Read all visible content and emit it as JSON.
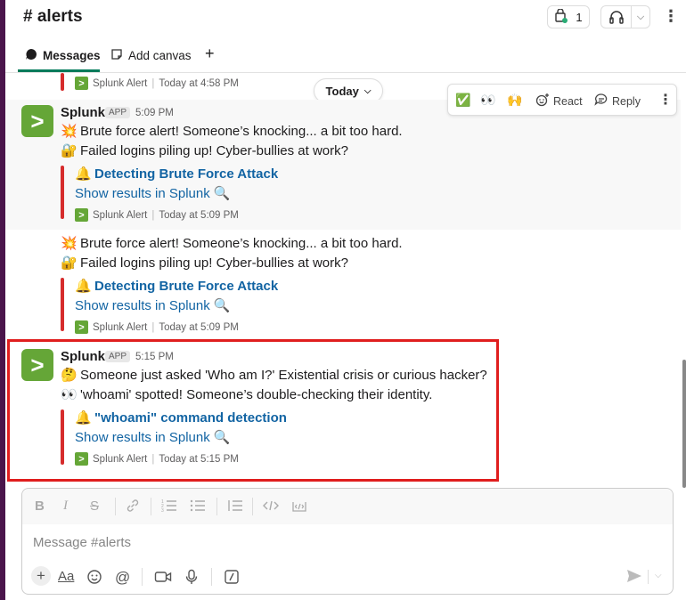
{
  "header": {
    "channel_title": "# alerts",
    "huddle_count": "1",
    "icons": [
      "huddle-icon",
      "headphones-icon",
      "chevron-down-icon",
      "more-vertical-icon"
    ]
  },
  "tabs": {
    "messages": "Messages",
    "add_canvas": "Add canvas",
    "add": "+"
  },
  "date_divider": "Today",
  "hover_actions": {
    "react_label": "React",
    "reply_label": "Reply",
    "quick_reactions": [
      "✅",
      "👀",
      "🙌"
    ]
  },
  "messages": [
    {
      "footer_source": "Splunk Alert",
      "footer_time": "Today at 4:58 PM"
    },
    {
      "sender": "Splunk",
      "badge": "APP",
      "time": "5:09 PM",
      "lines": [
        {
          "emoji": "💥",
          "text": "Brute force alert! Someone’s knocking... a bit too hard."
        },
        {
          "emoji": "🔐",
          "text": "Failed logins piling up! Cyber-bullies at work?"
        }
      ],
      "attachment_title_emoji": "🔔",
      "attachment_title": "Detecting Brute Force Attack",
      "attachment_link": "Show results in Splunk",
      "footer_source": "Splunk Alert",
      "footer_time": "Today at 5:09 PM"
    },
    {
      "lines": [
        {
          "emoji": "💥",
          "text": "Brute force alert! Someone’s knocking... a bit too hard."
        },
        {
          "emoji": "🔐",
          "text": "Failed logins piling up! Cyber-bullies at work?"
        }
      ],
      "attachment_title_emoji": "🔔",
      "attachment_title": "Detecting Brute Force Attack",
      "attachment_link": "Show results in Splunk",
      "footer_source": "Splunk Alert",
      "footer_time": "Today at 5:09 PM"
    },
    {
      "sender": "Splunk",
      "badge": "APP",
      "time": "5:15 PM",
      "lines": [
        {
          "emoji": "🤔",
          "text": "Someone just asked 'Who am I?' Existential crisis or curious hacker?"
        },
        {
          "emoji": "👀",
          "text": "'whoami' spotted! Someone’s double-checking their identity."
        }
      ],
      "attachment_title_emoji": "🔔",
      "attachment_title": "\"whoami\" command detection",
      "attachment_link": "Show results in Splunk",
      "footer_source": "Splunk Alert",
      "footer_time": "Today at 5:15 PM"
    }
  ],
  "composer": {
    "placeholder": "Message #alerts"
  },
  "colors": {
    "splunk_green": "#65a637",
    "link_blue": "#1264a3",
    "attachment_bar": "#d62c2c",
    "highlight_border": "#e01e1e",
    "sidebar": "#4a154b"
  }
}
